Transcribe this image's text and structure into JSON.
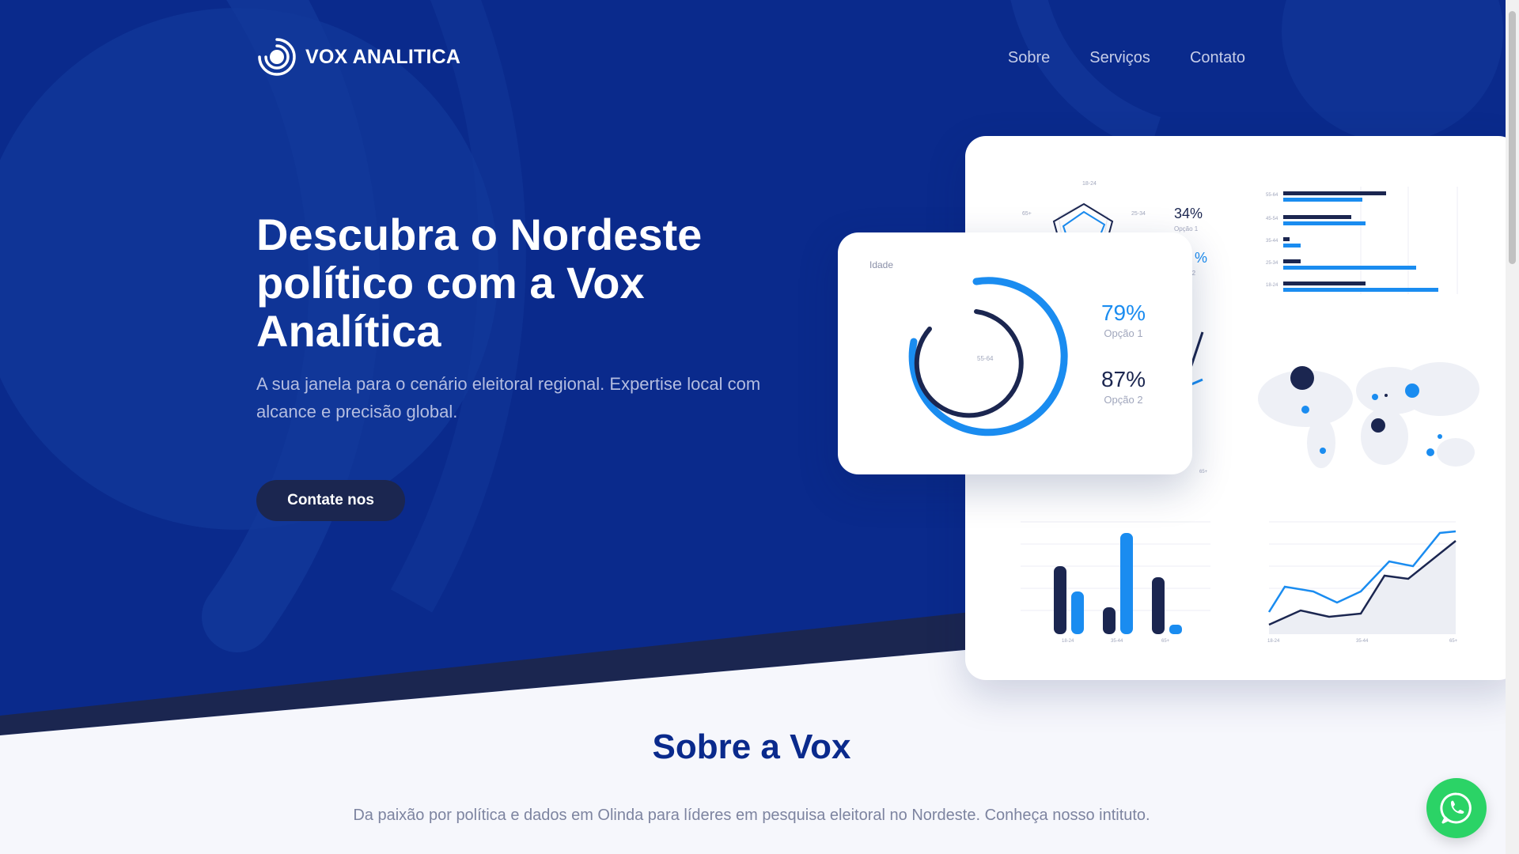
{
  "brand": {
    "name": "VOX ANALITICA"
  },
  "nav": {
    "items": [
      "Sobre",
      "Serviços",
      "Contato"
    ]
  },
  "hero": {
    "headline": "Descubra o Nordeste político com a Vox Analítica",
    "subtitle": "A sua janela para o cenário eleitoral regional. Expertise local com alcance e precisão global.",
    "cta_label": "Contate nos"
  },
  "front_card": {
    "label": "Idade",
    "center_label": "55-64",
    "stat1": {
      "value": "79%",
      "label": "Opção 1"
    },
    "stat2": {
      "value": "87%",
      "label": "Opção 2"
    }
  },
  "back_card": {
    "radar_labels": [
      "18-24",
      "25-34",
      "65+"
    ],
    "peek_stat": {
      "value": "34%",
      "label": "Opção 1"
    },
    "peek_stat2": {
      "value": "%",
      "label": "ã 2"
    },
    "hbar_labels": [
      "55-64",
      "45-54",
      "35-44",
      "25-34",
      "18-24"
    ],
    "vbar_labels": [
      "18-24",
      "35-44",
      "65+"
    ],
    "line_labels": [
      "18-24",
      "35-44",
      "65+"
    ],
    "misc_label": "65+"
  },
  "sobre": {
    "title": "Sobre a Vox",
    "text": "Da paixão por política e dados em Olinda para líderes em pesquisa eleitoral no Nordeste. Conheça nosso intituto."
  },
  "colors": {
    "navy": "#0a2a8c",
    "dark": "#1b2650",
    "accent": "#1a8cf0",
    "whatsapp": "#2bd366"
  },
  "icons": {
    "logo": "logo-rings-icon",
    "whatsapp": "whatsapp-icon"
  }
}
